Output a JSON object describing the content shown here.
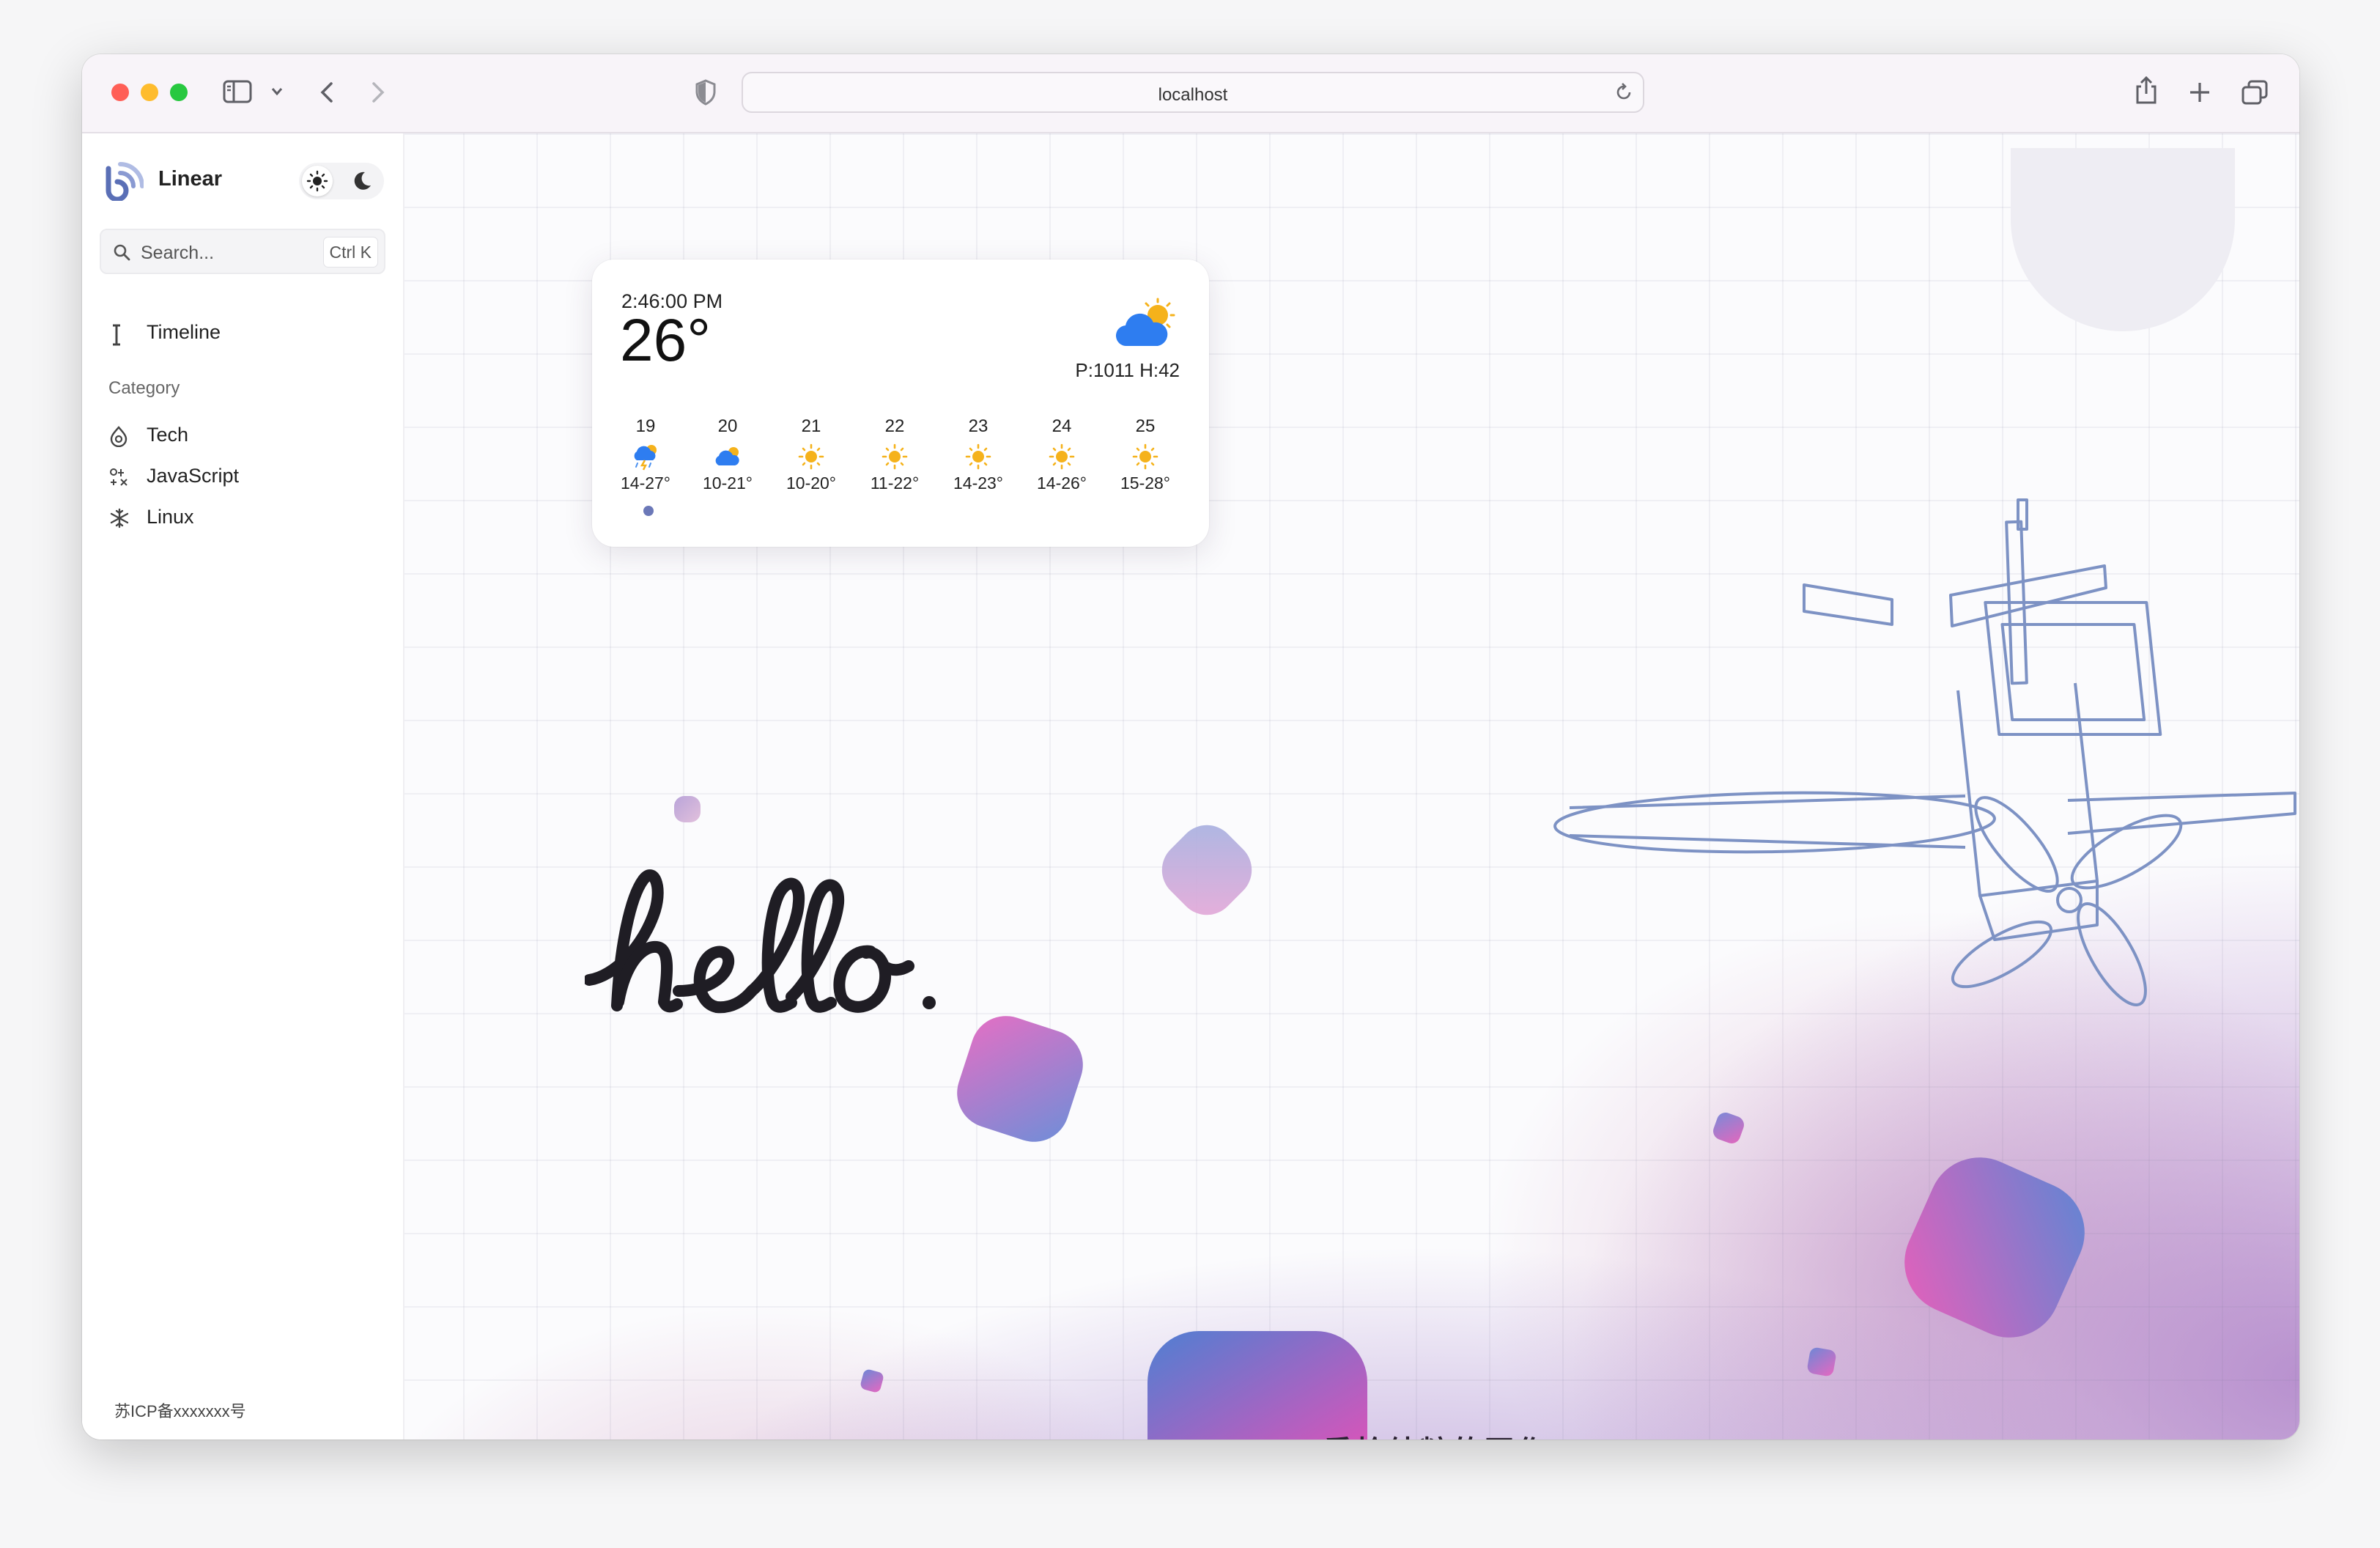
{
  "browser": {
    "url": "localhost"
  },
  "sidebar": {
    "brand": "Linear",
    "search": {
      "placeholder": "Search...",
      "shortcut": "Ctrl K"
    },
    "timeline_label": "Timeline",
    "category_heading": "Category",
    "categories": [
      {
        "label": "Tech",
        "icon": "tech-icon"
      },
      {
        "label": "JavaScript",
        "icon": "javascript-icon"
      },
      {
        "label": "Linux",
        "icon": "linux-icon"
      }
    ],
    "footer": "苏ICP备xxxxxxx号"
  },
  "weather": {
    "time": "2:46:00 PM",
    "temperature": "26°",
    "pressure_humidity": "P:1011 H:42",
    "current_icon": "partly-sunny-icon",
    "forecast": [
      {
        "day": "19",
        "range": "14-27°",
        "icon": "thunderstorm-icon"
      },
      {
        "day": "20",
        "range": "10-21°",
        "icon": "partly-cloudy-icon"
      },
      {
        "day": "21",
        "range": "10-20°",
        "icon": "sunny-icon"
      },
      {
        "day": "22",
        "range": "11-22°",
        "icon": "sunny-icon"
      },
      {
        "day": "23",
        "range": "14-23°",
        "icon": "sunny-icon"
      },
      {
        "day": "24",
        "range": "14-26°",
        "icon": "sunny-icon"
      },
      {
        "day": "25",
        "range": "15-28°",
        "icon": "sunny-icon"
      }
    ]
  },
  "hero": {
    "greeting": "hello.",
    "tagline": "重拾纯粹的写作"
  },
  "colors": {
    "accent": "#6b78b8",
    "sun": "#f5b21b",
    "cloud": "#2e7df0"
  }
}
